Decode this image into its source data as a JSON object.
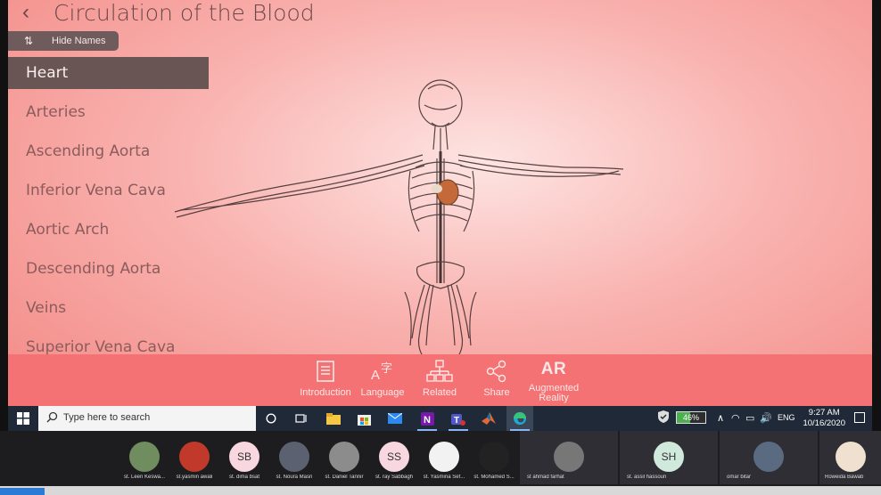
{
  "app": {
    "back_icon": "chevron-left-icon",
    "title": "Circulation of the Blood",
    "hide_names_label": "Hide Names",
    "parts": [
      {
        "label": "Heart",
        "active": true
      },
      {
        "label": "Arteries"
      },
      {
        "label": "Ascending Aorta"
      },
      {
        "label": "Inferior Vena Cava"
      },
      {
        "label": "Aortic Arch"
      },
      {
        "label": "Descending Aorta"
      },
      {
        "label": "Veins"
      },
      {
        "label": "Superior Vena Cava"
      }
    ],
    "toolbar": {
      "introduction": "Introduction",
      "language": "Language",
      "related": "Related",
      "share": "Share",
      "ar_glyph": "AR",
      "ar_label_1": "Augmented",
      "ar_label_2": "Reality"
    },
    "colors": {
      "toolbar": "#f47273",
      "active_item": "#6a5555",
      "accent_text": "#8a5c5c"
    }
  },
  "taskbar": {
    "search_placeholder": "Type here to search",
    "battery_level": 0.46,
    "battery_text": "46%",
    "language": "ENG",
    "time": "9:27 AM",
    "date": "10/16/2020"
  },
  "meeting": {
    "participants": [
      {
        "name": "st. Leen Keswa...",
        "initials": "",
        "color": "#6f8d5e"
      },
      {
        "name": "st.yasmin awali",
        "initials": "",
        "color": "#c0392b"
      },
      {
        "name": "st. dima bsat",
        "initials": "SB",
        "color": "#f8d7e0"
      },
      {
        "name": "st. Noura Masri",
        "initials": "",
        "color": "#5b6170"
      },
      {
        "name": "st. Daniel Tannir",
        "initials": "",
        "color": "#8c8c8c"
      },
      {
        "name": "st. ray Sabbagh",
        "initials": "SS",
        "color": "#f8d7e0"
      },
      {
        "name": "st. Yasmina Sef...",
        "initials": "",
        "color": "#f2f2f2"
      },
      {
        "name": "st. Mohamed S...",
        "initials": "",
        "color": "#222222"
      },
      {
        "name": "st ahmad farhat",
        "initials": "",
        "color": "#777777"
      },
      {
        "name": "st. assil hassoun",
        "initials": "SH",
        "color": "#cfe9dc"
      },
      {
        "name": "omar bitar",
        "initials": "",
        "color": "#5a6a80"
      },
      {
        "name": "Roweida Bawab",
        "initials": "",
        "color": "#f0e0d0"
      }
    ]
  }
}
